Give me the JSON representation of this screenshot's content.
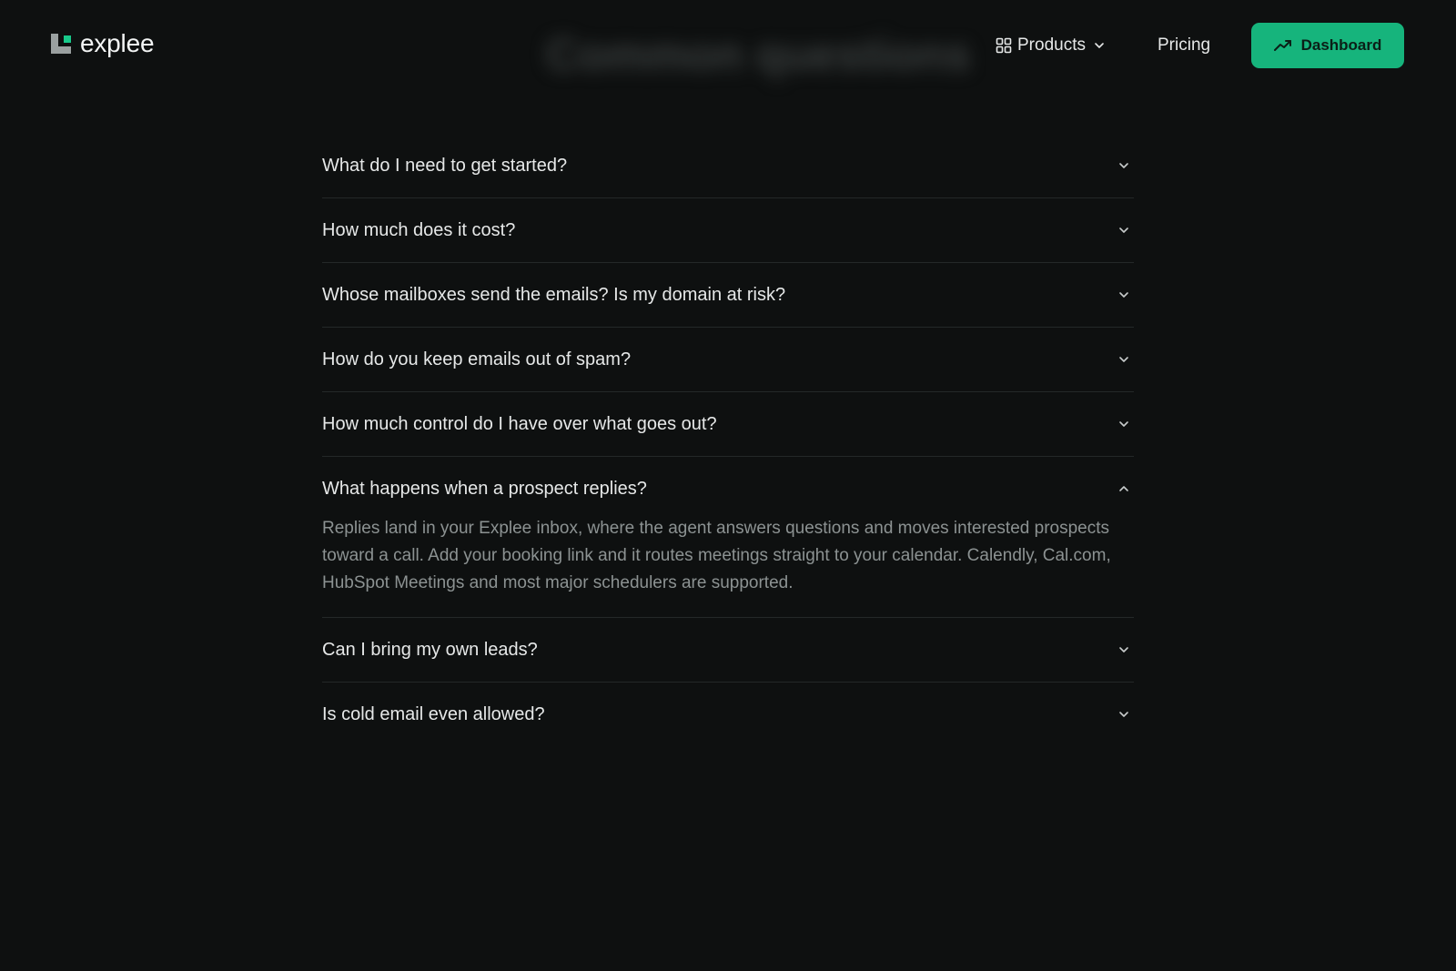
{
  "header": {
    "logo_text": "explee",
    "blurred_title": "Common questions",
    "nav": {
      "products_label": "Products",
      "pricing_label": "Pricing"
    },
    "cta_label": "Dashboard"
  },
  "faq": {
    "items": [
      {
        "question": "What do I need to get started?",
        "expanded": false
      },
      {
        "question": "How much does it cost?",
        "expanded": false
      },
      {
        "question": "Whose mailboxes send the emails? Is my domain at risk?",
        "expanded": false
      },
      {
        "question": "How do you keep emails out of spam?",
        "expanded": false
      },
      {
        "question": "How much control do I have over what goes out?",
        "expanded": false
      },
      {
        "question": "What happens when a prospect replies?",
        "expanded": true,
        "answer": "Replies land in your Explee inbox, where the agent answers questions and moves interested prospects toward a call. Add your booking link and it routes meetings straight to your calendar. Calendly, Cal.com, HubSpot Meetings and most major schedulers are supported."
      },
      {
        "question": "Can I bring my own leads?",
        "expanded": false
      },
      {
        "question": "Is cold email even allowed?",
        "expanded": false
      }
    ]
  },
  "colors": {
    "background": "#0e1010",
    "accent": "#16b47c",
    "logo_dot": "#18c98a",
    "divider": "#242828",
    "answer_text": "#8c9292"
  },
  "icons": {
    "products": "grid-icon",
    "dropdown": "chevron-down-icon",
    "cta": "trending-up-icon",
    "collapsed": "chevron-down-icon",
    "expanded": "chevron-up-icon"
  }
}
